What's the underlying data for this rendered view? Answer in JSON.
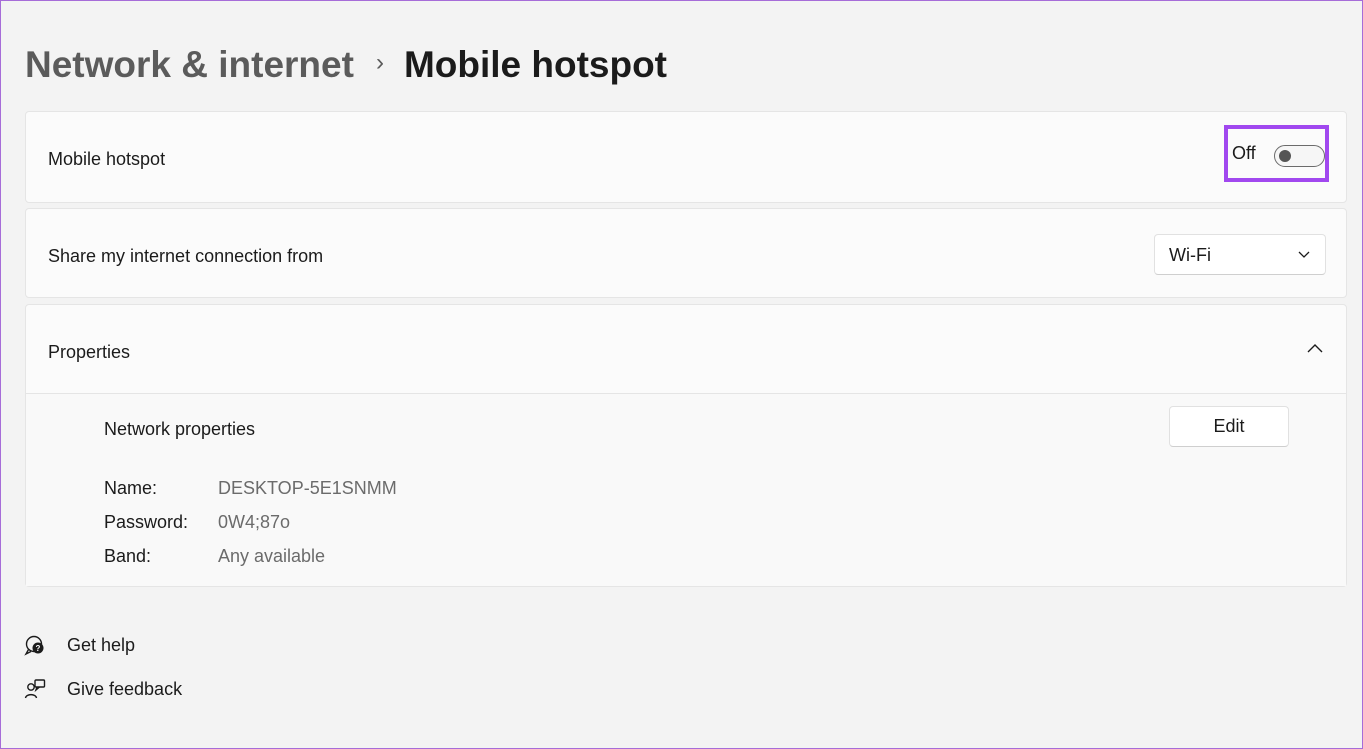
{
  "breadcrumb": {
    "parent": "Network & internet",
    "separator": "›",
    "current": "Mobile hotspot"
  },
  "hotspot": {
    "label": "Mobile hotspot",
    "state_label": "Off",
    "enabled": false,
    "highlight_color": "#a148ef"
  },
  "share": {
    "label": "Share my internet connection from",
    "selected": "Wi-Fi"
  },
  "properties": {
    "label": "Properties",
    "expanded": true,
    "network_properties_label": "Network properties",
    "edit_label": "Edit",
    "rows": [
      {
        "key": "Name:",
        "value": "DESKTOP-5E1SNMM"
      },
      {
        "key": "Password:",
        "value": "0W4;87o"
      },
      {
        "key": "Band:",
        "value": "Any available"
      }
    ]
  },
  "footer": {
    "help_label": "Get help",
    "help_icon": "help-chat-icon",
    "feedback_label": "Give feedback",
    "feedback_icon": "feedback-person-icon"
  }
}
